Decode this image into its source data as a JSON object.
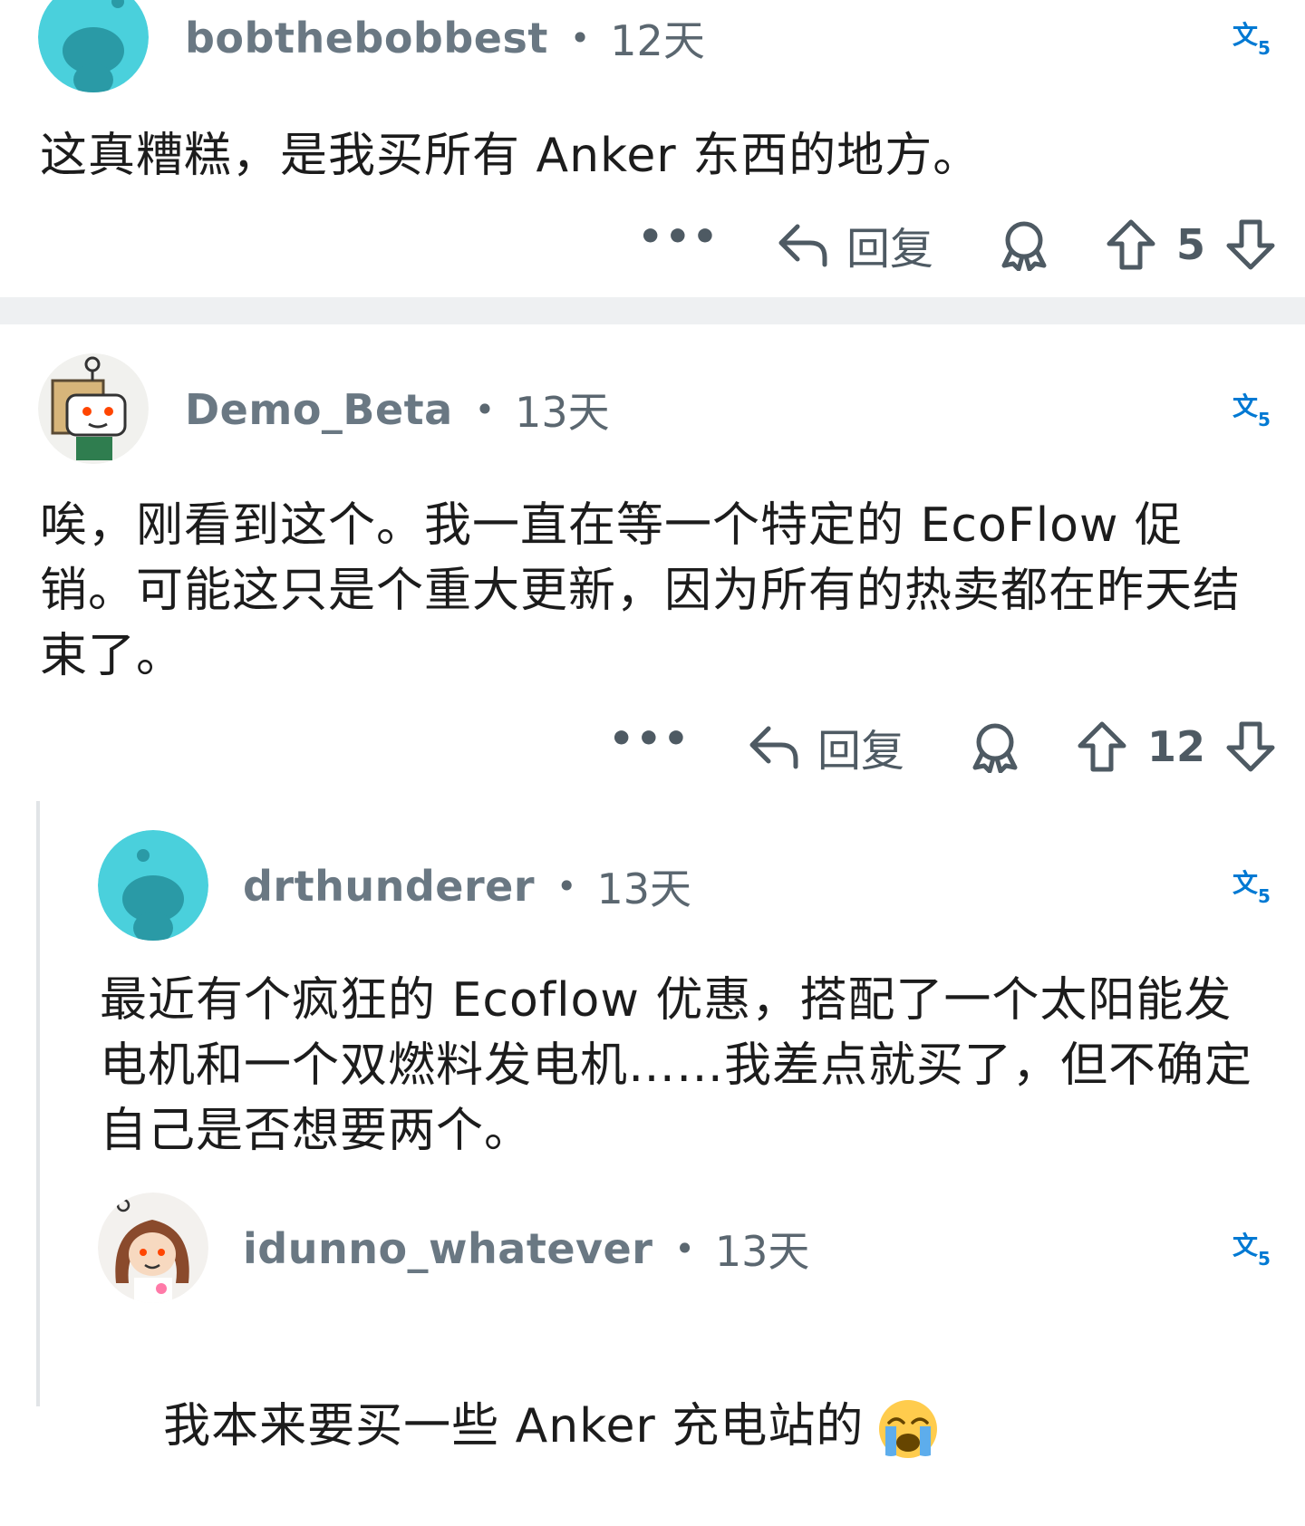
{
  "comments": [
    {
      "username": "bobthebobbest",
      "separator": "•",
      "time": "12天",
      "body": "这真糟糕，是我买所有 Anker 东西的地方。",
      "reply_label": "回复",
      "more_label": "•••",
      "votes": "5",
      "avatar_icon": "snoo-avatar-teal"
    },
    {
      "username": "Demo_Beta",
      "separator": "•",
      "time": "13天",
      "body": "唉，刚看到这个。我一直在等一个特定的 EcoFlow 促销。可能这只是个重大更新，因为所有的热卖都在昨天结束了。",
      "reply_label": "回复",
      "more_label": "•••",
      "votes": "12",
      "avatar_icon": "box-head-avatar"
    },
    {
      "username": "drthunderer",
      "separator": "•",
      "time": "13天",
      "body": "最近有个疯狂的 Ecoflow 优惠，搭配了一个太阳能发电机和一个双燃料发电机……我差点就买了，但不确定自己是否想要两个。",
      "avatar_icon": "snoo-avatar-teal"
    },
    {
      "username": "idunno_whatever",
      "separator": "•",
      "time": "13天",
      "body": "我本来要买一些 Anker 充电站的",
      "emoji": "loudly-crying-face",
      "avatar_icon": "brown-hair-avatar"
    }
  ],
  "colors": {
    "accent": "#0079d3",
    "meta_text": "#5b6770",
    "body_text": "#1c1c1c",
    "avatar_teal": "#46d1dd",
    "divider": "#eef0f2"
  }
}
